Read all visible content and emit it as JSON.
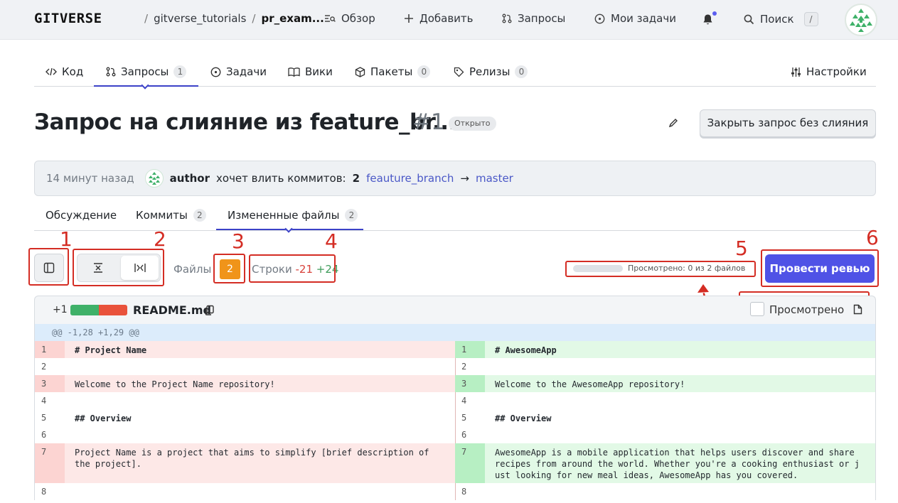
{
  "topbar": {
    "logo": "GITVERSE",
    "breadcrumb": {
      "owner": "gitverse_tutorials",
      "sep": "/",
      "repo": "pr_exam..."
    },
    "nav": {
      "overview": "Обзор",
      "add": "Добавить",
      "requests": "Запросы",
      "tasks": "Мои задачи",
      "search": "Поиск",
      "search_key": "/"
    }
  },
  "repo_tabs": {
    "code": "Код",
    "requests": "Запросы",
    "requests_count": "1",
    "tasks": "Задачи",
    "wiki": "Вики",
    "packages": "Пакеты",
    "packages_count": "0",
    "releases": "Релизы",
    "releases_count": "0",
    "settings": "Настройки"
  },
  "pr": {
    "title": "Запрос на слияние из feature_br...",
    "number": "#1",
    "status": "Открыто",
    "close_button": "Закрыть запрос без слияния",
    "time": "14 минут назад",
    "author": "author",
    "wants": "хочет влить коммитов:",
    "commits": "2",
    "from_branch": "feauture_branch",
    "arrow": "→",
    "to_branch": "master"
  },
  "sub_tabs": {
    "discussion": "Обсуждение",
    "commits": "Коммиты",
    "commits_count": "2",
    "changed": "Измененные файлы",
    "changed_count": "2"
  },
  "toolbar": {
    "files_label": "Файлы",
    "files_count": "2",
    "lines_label": "Строки",
    "lines_minus": "-21",
    "lines_plus": "+24",
    "viewed_progress": 0,
    "viewed_text": "Просмотрено:  0 из 2 файлов",
    "review_button": "Провести ревью"
  },
  "annotations": [
    "1",
    "2",
    "3",
    "4",
    "5",
    "6"
  ],
  "file": {
    "plus": "+1",
    "name": "README.md",
    "viewed_label": "Просмотрено",
    "hunk": "@@ -1,28 +1,29 @@",
    "rows": [
      {
        "l_num": "1",
        "l_code": "# Project Name",
        "r_num": "1",
        "r_code": "# AwesomeApp"
      },
      {
        "l_num": "2",
        "l_code": "",
        "r_num": "2",
        "r_code": ""
      },
      {
        "l_num": "3",
        "l_code": "Welcome to the Project Name repository!",
        "r_num": "3",
        "r_code": "Welcome to the AwesomeApp repository!"
      },
      {
        "l_num": "4",
        "l_code": "",
        "r_num": "4",
        "r_code": ""
      },
      {
        "l_num": "5",
        "l_code": "## Overview",
        "r_num": "5",
        "r_code": "## Overview"
      },
      {
        "l_num": "6",
        "l_code": "",
        "r_num": "6",
        "r_code": ""
      },
      {
        "l_num": "7",
        "l_code": "Project Name is a project that aims to simplify [brief description of\nthe project].",
        "r_num": "7",
        "r_code": "AwesomeApp is a mobile application that helps users discover and share\nrecipes from around the world. Whether you're a cooking enthusiast or j\nust looking for new meal ideas, AwesomeApp has you covered."
      },
      {
        "l_num": "8",
        "l_code": "",
        "r_num": "8",
        "r_code": ""
      }
    ]
  },
  "colors": {
    "accent": "#4f52e6",
    "annotation": "#d42d24",
    "deleted": "#fde8e7",
    "added": "#e2f9e6"
  }
}
